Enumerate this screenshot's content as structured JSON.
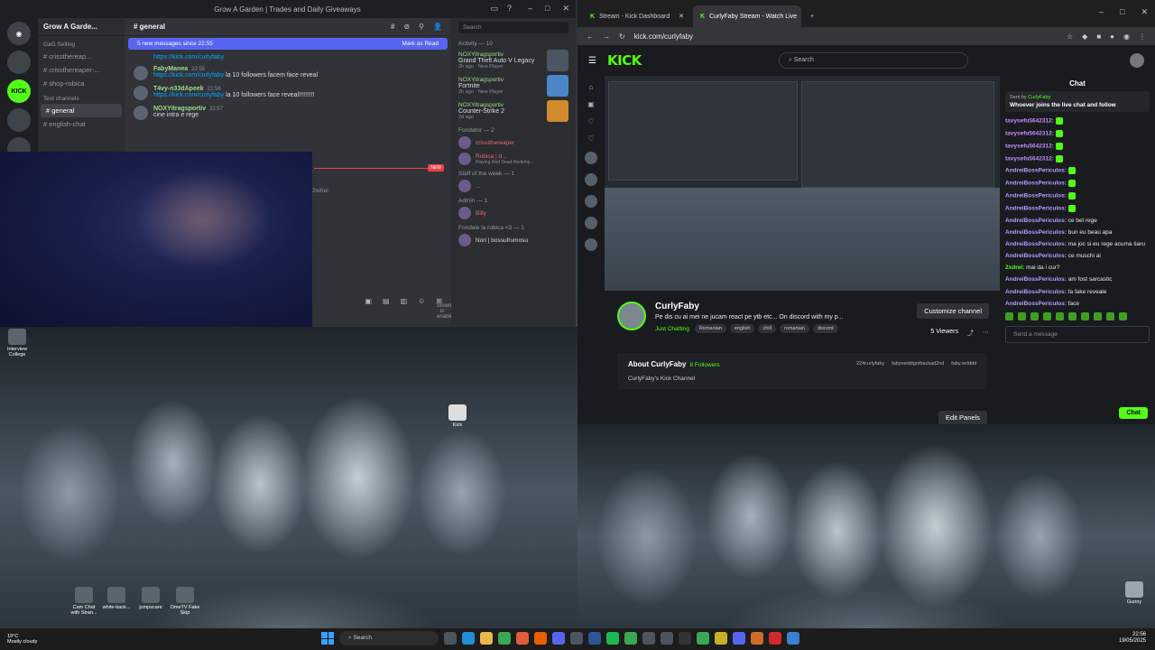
{
  "discord": {
    "window_title": "Grow A Garden | Trades and Daily Giveaways",
    "server_name": "Grow A Garde...",
    "categories": {
      "selling": "GaG Selling",
      "text": "Text channels"
    },
    "channels": [
      "crissthereap...",
      "crissthereaper-...",
      "shop-robica",
      "general",
      "english-chat"
    ],
    "active_channel": "general",
    "header_channel": "general",
    "new_messages": "5 new messages since 22:55",
    "mark_read": "Mark as Read",
    "messages": [
      {
        "author": "",
        "time": "",
        "text": "https://kick.com/curlyfaby",
        "link": true
      },
      {
        "author": "FabyManea",
        "time": "22:55",
        "link_text": "https://kick.com/curlyfaby",
        "text": " la 10 followers facem face reveal"
      },
      {
        "author": "T4vy-n33dApeek",
        "time": "22:56",
        "link_text": "https://kick.com/curlyfaby",
        "text": " la 10 followers face reveal!!!!!!!!!"
      },
      {
        "author": "NOXYitragsportiv",
        "time": "22:57",
        "text": "cine intra e rege"
      }
    ],
    "new_label": "NEW",
    "mention": "2xdrel",
    "slowmode": "Slowmode is enabled.",
    "search_placeholder": "Search",
    "activity_title": "Activity — 10",
    "activities": [
      {
        "user": "NOXYitragsportiv",
        "game": "Grand Theft Auto V Legacy",
        "sub": "2h ago · New Player"
      },
      {
        "user": "NOXYitragsportiv",
        "game": "Fortnite",
        "sub": "2h ago · New Player"
      },
      {
        "user": "NOXYitragsportiv",
        "game": "Counter-Strike 2",
        "sub": "2d ago"
      }
    ],
    "sections": {
      "founder": "Fondator — 2",
      "staff": "Staff of the week — 1",
      "admin": "Admin — 1",
      "fondele": "Fondele la robica <3 — 1"
    },
    "members": [
      {
        "name": "crisstthereaper",
        "sub": ""
      },
      {
        "name": "Robica | d...",
        "sub": "Playing Red Dead Redemp..."
      },
      {
        "name": "...",
        "sub": ""
      },
      {
        "name": "Billy",
        "sub": ""
      },
      {
        "name": "Nori | bossufrumosu",
        "sub": ""
      }
    ]
  },
  "browser": {
    "tabs": [
      {
        "label": "Stream - Kick Dashboard"
      },
      {
        "label": "CurlyFaby Stream - Watch Live"
      }
    ],
    "url": "kick.com/curlyfaby",
    "search_placeholder": "Search",
    "logo": "KICK"
  },
  "channel": {
    "name": "CurlyFaby",
    "title": "Pe dis cu ai mei ne jucam react pe ytb etc... On discord with my p...",
    "category": "Just Chatting",
    "tags": [
      "Romanian",
      "english",
      "chill",
      "romanian",
      "discord"
    ],
    "customize": "Customize channel",
    "viewers": "5 Viewers",
    "about_title": "About CurlyFaby",
    "followers": "8 Followers",
    "description": "CurlyFaby's Kick Channel",
    "socials": [
      "224curlyfaby",
      "fabyveiddgothackad2nd",
      "faby.wrlddd"
    ],
    "edit_panels": "Edit Panels"
  },
  "chat": {
    "title": "Chat",
    "pinned_by": "Sent by",
    "pinned_user": "CurlyFaby",
    "pinned_text": "Whoever joins the live chat and follow",
    "messages": [
      {
        "user": "tavysefu5642312:",
        "text": "",
        "color": "#c28cff"
      },
      {
        "user": "tavysefu5642312:",
        "text": "",
        "color": "#c28cff"
      },
      {
        "user": "tavysefu5642312:",
        "text": "",
        "color": "#c28cff"
      },
      {
        "user": "tavysefu5642312:",
        "text": "",
        "color": "#c28cff"
      },
      {
        "user": "AndreiBossPericulos:",
        "text": "",
        "color": "#b59cff"
      },
      {
        "user": "AndreiBossPericulos:",
        "text": "",
        "color": "#b59cff"
      },
      {
        "user": "AndreiBossPericulos:",
        "text": "",
        "color": "#b59cff"
      },
      {
        "user": "AndreiBossPericulos:",
        "text": "",
        "color": "#b59cff"
      },
      {
        "user": "AndreiBossPericulos:",
        "text": " ce bel rege",
        "color": "#b59cff"
      },
      {
        "user": "AndreiBossPericulos:",
        "text": " bun eu beau apa",
        "color": "#b59cff"
      },
      {
        "user": "AndreiBossPericulos:",
        "text": " ma joc si eu rege acuma tiaru",
        "color": "#b59cff"
      },
      {
        "user": "AndreiBossPericulos:",
        "text": " ce muschi ai",
        "color": "#b59cff"
      },
      {
        "user": "2xdrel:",
        "text": " mai da i cur?",
        "color": "#53fc18"
      },
      {
        "user": "AndreiBossPericulos:",
        "text": " am fost sarcastic",
        "color": "#b59cff"
      },
      {
        "user": "AndreiBossPericulos:",
        "text": " fa fake reveale",
        "color": "#b59cff"
      },
      {
        "user": "AndreiBossPericulos:",
        "text": " face",
        "color": "#b59cff"
      }
    ],
    "send_placeholder": "Send a message",
    "send_button": "Chat"
  },
  "desktop": {
    "icons": [
      {
        "label": "Interview College"
      },
      {
        "label": "Kick"
      },
      {
        "label": "Cam Chat with Stran..."
      },
      {
        "label": "white-back..."
      },
      {
        "label": "jumpscare"
      },
      {
        "label": "OmeTV Fake Skip"
      },
      {
        "label": "Gunoy"
      }
    ]
  },
  "taskbar": {
    "temp": "19°C",
    "weather": "Mostly cloudy",
    "search": "Search",
    "time": "22:56",
    "date": "19/05/2025"
  }
}
